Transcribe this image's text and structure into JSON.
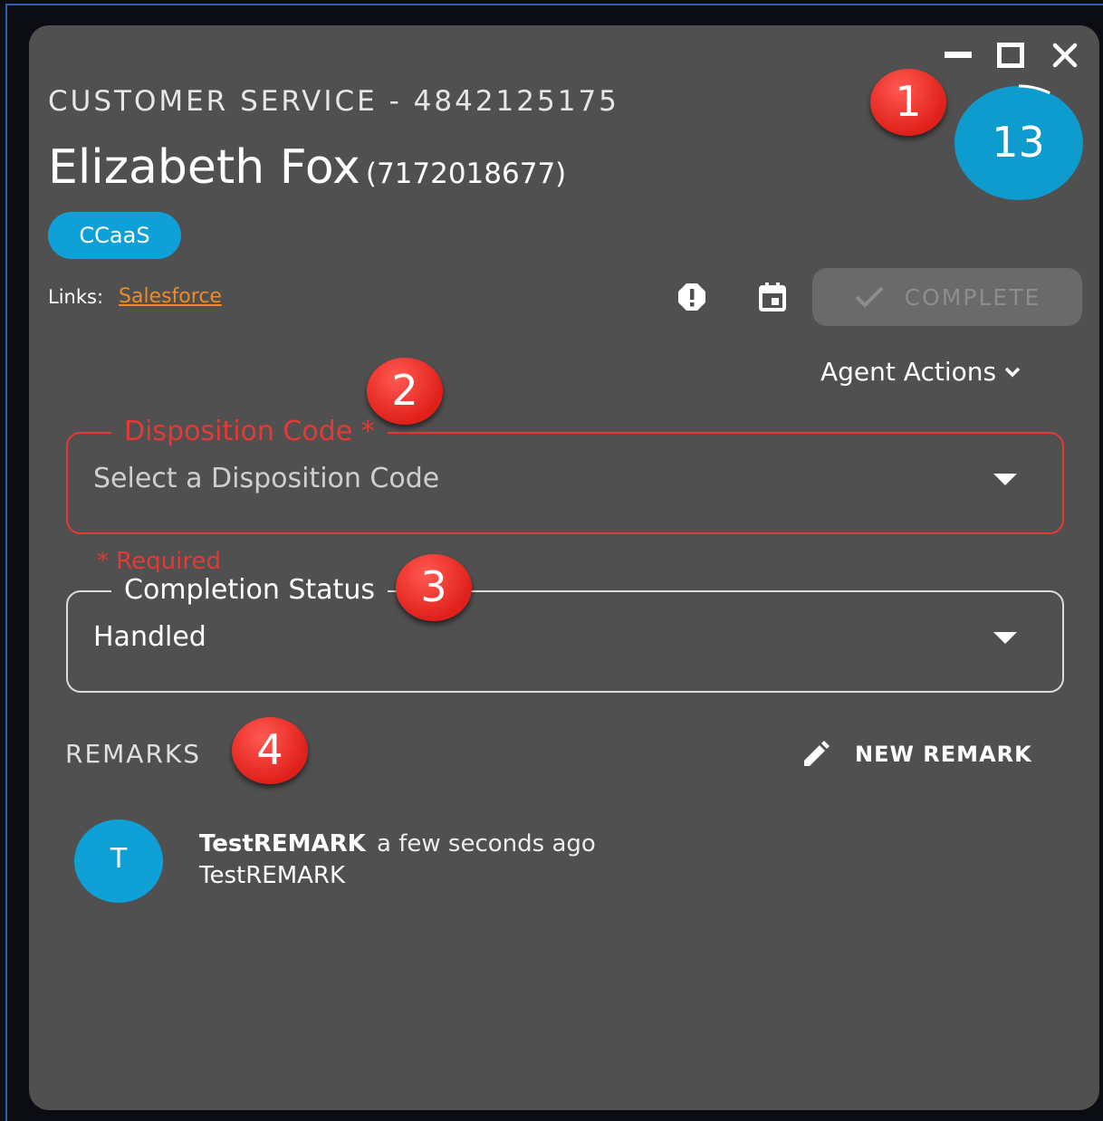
{
  "window": {
    "minimize_icon": "minimize-icon",
    "maximize_icon": "maximize-icon",
    "close_icon": "close-icon"
  },
  "header": {
    "queue_title": "CUSTOMER SERVICE - 4842125175",
    "customer_name": "Elizabeth Fox",
    "customer_phone": "(7172018677)",
    "tag": "CCaaS",
    "timer": "13",
    "timer_progress_fraction": 0.08
  },
  "links": {
    "label": "Links:",
    "items": [
      {
        "label": "Salesforce"
      }
    ]
  },
  "toolbar": {
    "alert_icon": "alert-circle-icon",
    "calendar_icon": "calendar-icon",
    "complete_label": "COMPLETE",
    "agent_actions_label": "Agent Actions"
  },
  "disposition": {
    "label": "Disposition Code *",
    "placeholder": "Select a Disposition Code",
    "required_note": "* Required"
  },
  "completion_status": {
    "label": "Completion Status",
    "value": "Handled"
  },
  "remarks": {
    "title": "REMARKS",
    "new_label": "NEW REMARK",
    "items": [
      {
        "avatar_initial": "T",
        "author": "TestREMARK",
        "time": "a few seconds ago",
        "text": "TestREMARK"
      }
    ]
  },
  "annotations": [
    "1",
    "2",
    "3",
    "4"
  ],
  "colors": {
    "panel": "#505050",
    "accent": "#0ea0d6",
    "link": "#f08a24",
    "error": "#e53935",
    "marker": "#e0201a"
  }
}
